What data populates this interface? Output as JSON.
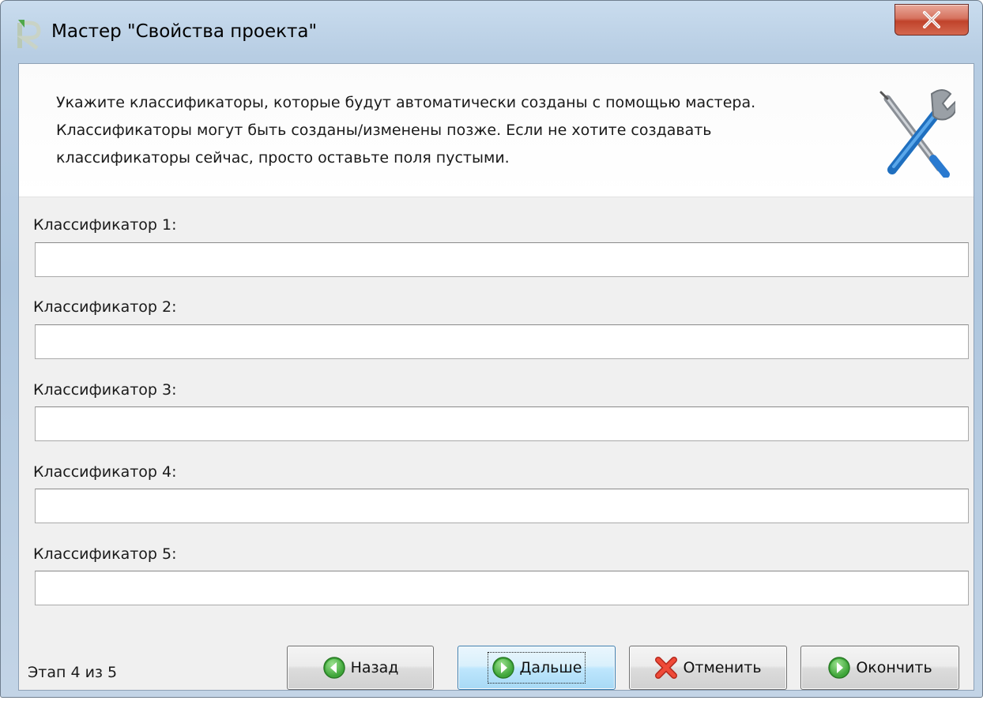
{
  "window": {
    "title": "Мастер \"Свойства проекта\"",
    "close_label": "X"
  },
  "header": {
    "lines": [
      "Укажите классификаторы, которые будут автоматически созданы с помощью мастера.",
      "Классификаторы могут быть созданы/изменены позже. Если не хотите создавать",
      "классификаторы сейчас, просто оставьте поля пустыми."
    ]
  },
  "fields": [
    {
      "label": "Классификатор 1:",
      "value": ""
    },
    {
      "label": "Классификатор 2:",
      "value": ""
    },
    {
      "label": "Классификатор 3:",
      "value": ""
    },
    {
      "label": "Классификатор 4:",
      "value": ""
    },
    {
      "label": "Классификатор 5:",
      "value": ""
    }
  ],
  "footer": {
    "step": "Этап 4 из 5",
    "buttons": {
      "back": "Назад",
      "next": "Дальше",
      "cancel": "Отменить",
      "finish": "Окончить"
    }
  },
  "icons": {
    "app": "app-r-logo-icon",
    "header": "tools-wrench-screwdriver-icon",
    "back": "back-arrow-icon",
    "next": "next-arrow-icon",
    "cancel": "red-x-icon",
    "finish": "finish-arrow-icon"
  },
  "colors": {
    "button_icon_green": "#3fa83a",
    "cancel_red": "#e03a2a",
    "close_button_red": "#c0432b"
  }
}
